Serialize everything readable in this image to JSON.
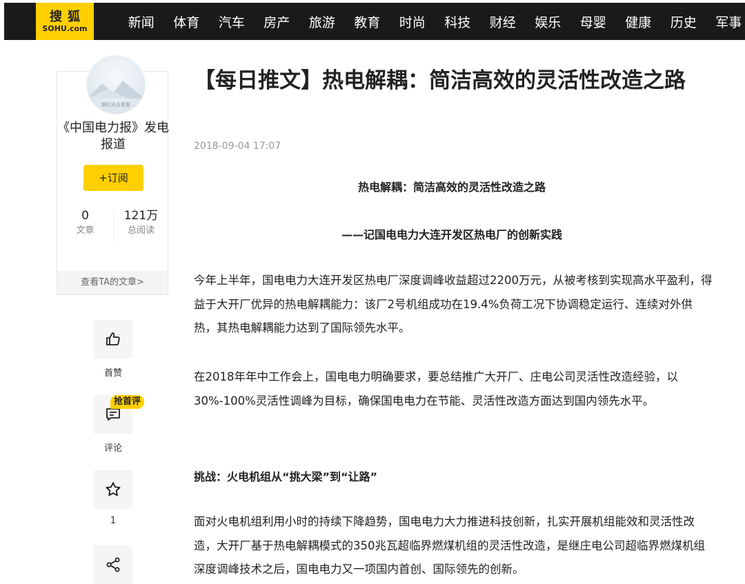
{
  "logo": {
    "cn": "搜狐",
    "en": "SOHU.com"
  },
  "nav": [
    "新闻",
    "体育",
    "汽车",
    "房产",
    "旅游",
    "教育",
    "时尚",
    "科技",
    "财经",
    "娱乐",
    "母婴",
    "健康",
    "历史",
    "军事"
  ],
  "sidebar": {
    "avatar_text": "聊时光去看看",
    "author": "《中国电力报》发电报道",
    "subscribe": "+订阅",
    "stats": [
      {
        "value": "0",
        "label": "文章"
      },
      {
        "value": "121万",
        "label": "总阅读"
      }
    ],
    "more": "查看TA的文章>"
  },
  "actions": {
    "like_label": "首赞",
    "comment_label": "评论",
    "comment_badge": "抢首评",
    "favorite_count": "1"
  },
  "article": {
    "title": "【每日推文】热电解耦：简洁高效的灵活性改造之路",
    "date": "2018-09-04 17:07",
    "heading1": "热电解耦：简洁高效的灵活性改造之路",
    "heading2": "——记国电电力大连开发区热电厂的创新实践",
    "p1": "今年上半年，国电电力大连开发区热电厂深度调峰收益超过2200万元，从被考核到实现高水平盈利，得益于大开厂优异的热电解耦能力：该厂2号机组成功在19.4%负荷工况下协调稳定运行、连续对外供热，其热电解耦能力达到了国际领先水平。",
    "p2": "在2018年年中工作会上，国电电力明确要求，要总结推广大开厂、庄电公司灵活性改造经验，以30%-100%灵活性调峰为目标，确保国电电力在节能、灵活性改造方面达到国内领先水平。",
    "subheading": "挑战：火电机组从“挑大梁”到“让路”",
    "p3": "面对火电机组利用小时的持续下降趋势，国电电力大力推进科技创新，扎实开展机组能效和灵活性改造，大开厂基于热电解耦模式的350兆瓦超临界燃煤机组的灵活性改造，是继庄电公司超临界燃煤机组深度调峰技术之后，国电电力又一项国内首创、国际领先的创新。"
  }
}
